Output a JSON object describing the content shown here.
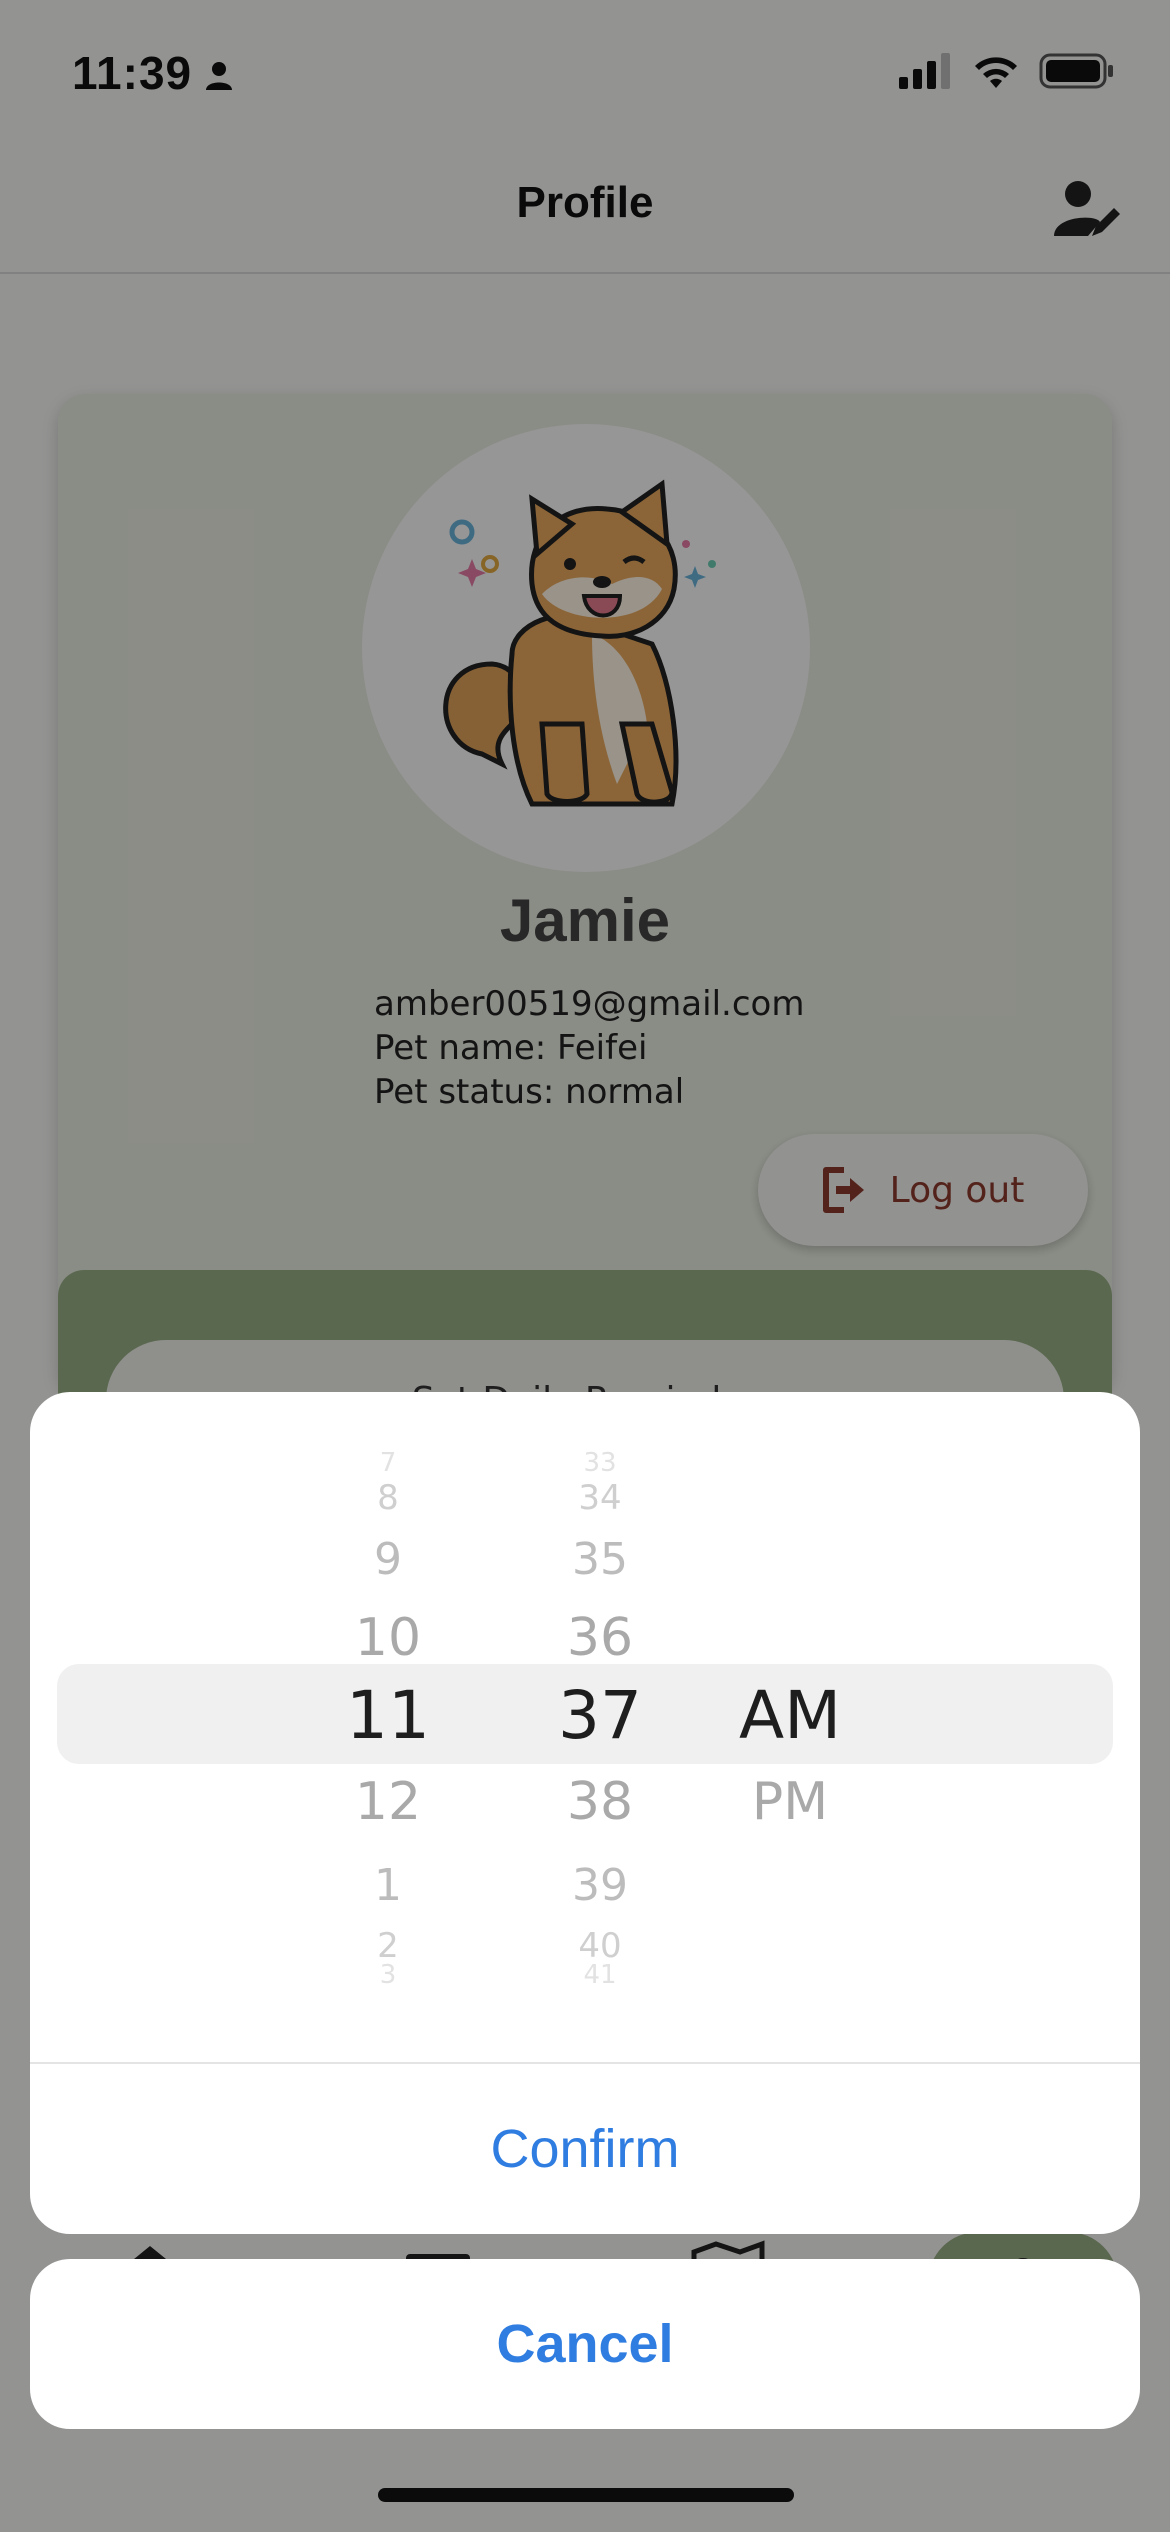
{
  "status_bar": {
    "time": "11:39"
  },
  "nav": {
    "title": "Profile"
  },
  "profile": {
    "name": "Jamie",
    "email": "amber00519@gmail.com",
    "pet_name": "Pet name: Feifei",
    "pet_status": "Pet status: normal",
    "logout_label": "Log out"
  },
  "reminder": {
    "label": "Set Daily Reminder"
  },
  "picker": {
    "hours": {
      "above": [
        "7",
        "8",
        "9",
        "10"
      ],
      "selected": "11",
      "below": [
        "12",
        "1",
        "2",
        "3"
      ]
    },
    "minutes": {
      "above": [
        "33",
        "34",
        "35",
        "36"
      ],
      "selected": "37",
      "below": [
        "38",
        "39",
        "40",
        "41"
      ]
    },
    "period": {
      "selected": "AM",
      "below": [
        "PM"
      ]
    }
  },
  "actions": {
    "confirm_label": "Confirm",
    "cancel_label": "Cancel"
  },
  "colors": {
    "accent_blue": "#2f7de1",
    "card_green": "#98ae85",
    "logout_red": "#8a3a2c"
  }
}
